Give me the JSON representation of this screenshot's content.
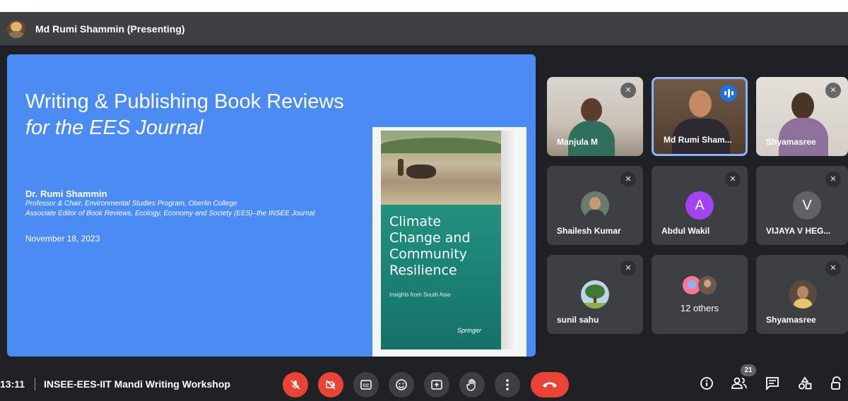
{
  "presenter": {
    "title": "Md Rumi Shammin (Presenting)"
  },
  "slide": {
    "title_line1": "Writing & Publishing Book Reviews",
    "title_line2": "for the EES Journal",
    "author": "Dr. Rumi Shammin",
    "affiliation1": "Professor & Chair, Environmental Studies Program, Oberlin College",
    "affiliation2": "Associate Editor of Book Reviews, Ecology, Economy and Society (EES)–the INSEE Journal",
    "date": "November 18, 2023",
    "book": {
      "title": "Climate Change and Community Resilience",
      "subtitle": "Insights from South Asia",
      "publisher": "Springer"
    }
  },
  "participants": [
    {
      "name": "Manjula M",
      "muted": true,
      "type": "video"
    },
    {
      "name": "Md Rumi Sham...",
      "speaking": true,
      "type": "video"
    },
    {
      "name": "Shyamasree",
      "muted": true,
      "type": "video"
    },
    {
      "name": "Shailesh Kumar",
      "muted": true,
      "type": "photo"
    },
    {
      "name": "Abdul Wakil",
      "muted": true,
      "type": "letter",
      "letter": "A",
      "color": "#a142f4"
    },
    {
      "name": "VIJAYA V HEG...",
      "muted": true,
      "type": "letter",
      "letter": "V",
      "color": "#5f6368"
    },
    {
      "name": "sunil sahu",
      "muted": true,
      "type": "photo"
    },
    {
      "name": "12 others",
      "type": "group"
    },
    {
      "name": "Shyamasree",
      "muted": true,
      "type": "photo"
    }
  ],
  "bottombar": {
    "time": "13:11",
    "meeting_name": "INSEE-EES-IIT Mandi Writing Workshop",
    "participant_count": "21",
    "controls": [
      "mic-off-icon",
      "camera-off-icon",
      "captions-icon",
      "emoji-icon",
      "present-icon",
      "raise-hand-icon",
      "more-options-icon",
      "end-call-icon"
    ],
    "right_icons": [
      "info-icon",
      "people-icon",
      "chat-icon",
      "activities-icon",
      "host-controls-icon"
    ]
  },
  "colors": {
    "background": "#202124",
    "tile": "#3c4043",
    "slide": "#4b8bf4",
    "danger": "#ea4335",
    "accent": "#1a73e8"
  }
}
